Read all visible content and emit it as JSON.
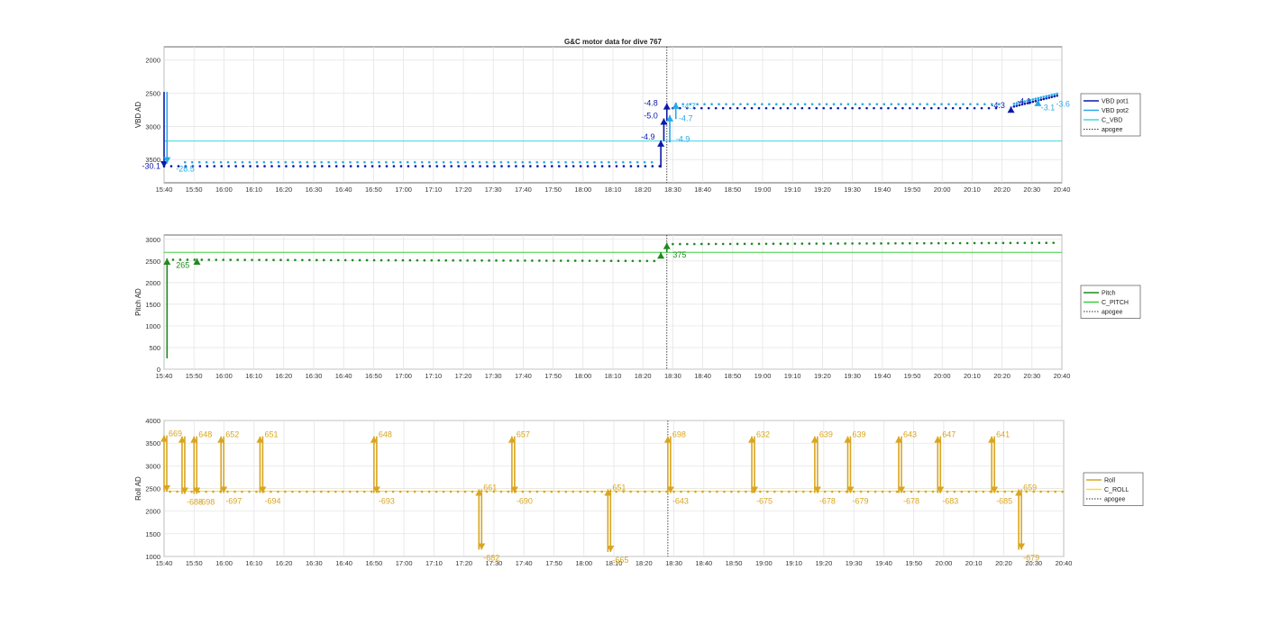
{
  "figure": {
    "title": "G&C motor data for dive 767"
  },
  "chart_data": [
    {
      "type": "scatter",
      "id": "vbd",
      "ylabel": "VBD AD",
      "ylim": [
        3850,
        1800
      ],
      "yticks": [
        2000,
        2500,
        3000,
        3500
      ],
      "xlim": [
        "15:40",
        "20:40"
      ],
      "xticks": [
        "15:40",
        "15:50",
        "16:00",
        "16:10",
        "16:20",
        "16:30",
        "16:40",
        "16:50",
        "17:00",
        "17:10",
        "17:20",
        "17:30",
        "17:40",
        "17:50",
        "18:00",
        "18:10",
        "18:20",
        "18:30",
        "18:40",
        "18:50",
        "19:00",
        "19:10",
        "19:20",
        "19:30",
        "19:40",
        "19:50",
        "20:00",
        "20:10",
        "20:20",
        "20:30",
        "20:40"
      ],
      "grid": true,
      "legend": {
        "placement": "right",
        "entries": [
          {
            "label": "VBD pot1",
            "color": "#0a1aa8",
            "style": "solid"
          },
          {
            "label": "VBD pot2",
            "color": "#2aa8e8",
            "style": "solid"
          },
          {
            "label": "C_VBD",
            "color": "#3fd6e6",
            "style": "solid"
          },
          {
            "label": "apogee",
            "color": "#333333",
            "style": "dotted"
          }
        ]
      },
      "reference_lines": [
        {
          "name": "C_VBD",
          "y": 3220,
          "color": "#3fd6e6"
        }
      ],
      "apogee_x": "18:28",
      "series": [
        {
          "name": "VBD pot1",
          "color": "#0a1aa8",
          "segments": [
            {
              "x": [
                "15:40",
                "18:26"
              ],
              "y": 3600
            },
            {
              "x": [
                "18:30",
                "20:20"
              ],
              "y": 2725
            },
            {
              "x": [
                "20:24",
                "20:39"
              ],
              "y": [
                2700,
                2530
              ]
            }
          ]
        },
        {
          "name": "VBD pot2",
          "color": "#2aa8e8",
          "segments": [
            {
              "x": [
                "15:47",
                "18:25"
              ],
              "y": 3540
            },
            {
              "x": [
                "18:31",
                "20:20"
              ],
              "y": 2665
            },
            {
              "x": [
                "20:24",
                "20:39"
              ],
              "y": [
                2660,
                2500
              ]
            }
          ]
        }
      ],
      "arrows": [
        {
          "x": "15:40",
          "from": 2480,
          "to": 3620,
          "color": "#0a1aa8"
        },
        {
          "x": "15:41",
          "from": 2480,
          "to": 3560,
          "color": "#2aa8e8"
        },
        {
          "x": "18:26",
          "from": 3620,
          "to": 3210,
          "color": "#0a1aa8"
        },
        {
          "x": "18:27",
          "from": 3220,
          "to": 2880,
          "color": "#0a1aa8"
        },
        {
          "x": "18:28",
          "from": 2920,
          "to": 2650,
          "color": "#0a1aa8"
        },
        {
          "x": "18:29",
          "from": 3240,
          "to": 2830,
          "color": "#2aa8e8"
        },
        {
          "x": "18:31",
          "from": 2890,
          "to": 2640,
          "color": "#2aa8e8"
        },
        {
          "x": "20:23",
          "from": 2735,
          "to": 2700,
          "color": "#0a1aa8"
        },
        {
          "x": "20:32",
          "from": 2680,
          "to": 2600,
          "color": "#2aa8e8"
        }
      ],
      "annotations": [
        {
          "text": "-30.1",
          "x": "15:40",
          "y": 3640,
          "color": "#0a1aa8",
          "anchor": "end",
          "dx": -4
        },
        {
          "text": "-28.5",
          "x": "15:44",
          "y": 3680,
          "color": "#2aa8e8",
          "anchor": "start"
        },
        {
          "text": "-4.8",
          "x": "18:25",
          "y": 2690,
          "color": "#0a1aa8",
          "anchor": "end"
        },
        {
          "text": "-5.0",
          "x": "18:25",
          "y": 2880,
          "color": "#0a1aa8",
          "anchor": "end"
        },
        {
          "text": "-4.9",
          "x": "18:24",
          "y": 3200,
          "color": "#0a1aa8",
          "anchor": "end"
        },
        {
          "text": "-4.7",
          "x": "18:33",
          "y": 2740,
          "color": "#2aa8e8",
          "anchor": "start"
        },
        {
          "text": "-4.7",
          "x": "18:32",
          "y": 2920,
          "color": "#2aa8e8",
          "anchor": "start"
        },
        {
          "text": "-4.9",
          "x": "18:31",
          "y": 3230,
          "color": "#2aa8e8",
          "anchor": "start"
        },
        {
          "text": "-4.3",
          "x": "20:21",
          "y": 2720,
          "color": "#0a1aa8",
          "anchor": "end"
        },
        {
          "text": "-4.1",
          "x": "20:25",
          "y": 2660,
          "color": "#0a1aa8",
          "anchor": "start"
        },
        {
          "text": "-3.1",
          "x": "20:33",
          "y": 2760,
          "color": "#2aa8e8",
          "anchor": "start"
        },
        {
          "text": "-3.6",
          "x": "20:38",
          "y": 2700,
          "color": "#2aa8e8",
          "anchor": "start"
        }
      ]
    },
    {
      "type": "scatter",
      "id": "pitch",
      "ylabel": "Pitch AD",
      "ylim": [
        0,
        3100
      ],
      "yticks": [
        0,
        500,
        1000,
        1500,
        2000,
        2500,
        3000
      ],
      "xlim": [
        "15:40",
        "20:40"
      ],
      "xticks": [
        "15:40",
        "15:50",
        "16:00",
        "16:10",
        "16:20",
        "16:30",
        "16:40",
        "16:50",
        "17:00",
        "17:10",
        "17:20",
        "17:30",
        "17:40",
        "17:50",
        "18:00",
        "18:10",
        "18:20",
        "18:30",
        "18:40",
        "18:50",
        "19:00",
        "19:10",
        "19:20",
        "19:30",
        "19:40",
        "19:50",
        "20:00",
        "20:10",
        "20:20",
        "20:30",
        "20:40"
      ],
      "grid": true,
      "legend": {
        "placement": "right",
        "entries": [
          {
            "label": "Pitch",
            "color": "#1e8a1e",
            "style": "solid"
          },
          {
            "label": "C_PITCH",
            "color": "#3ccf3c",
            "style": "solid"
          },
          {
            "label": "apogee",
            "color": "#333333",
            "style": "dotted"
          }
        ]
      },
      "reference_lines": [
        {
          "name": "C_PITCH",
          "y": 2700,
          "color": "#3ccf3c"
        }
      ],
      "apogee_x": "18:28",
      "series": [
        {
          "name": "Pitch",
          "color": "#1e8a1e",
          "segments": [
            {
              "x": [
                "15:43",
                "18:26"
              ],
              "y": [
                2530,
                2500
              ]
            },
            {
              "x": [
                "18:30",
                "20:39"
              ],
              "y": [
                2890,
                2920
              ]
            }
          ]
        }
      ],
      "arrows": [
        {
          "x": "15:41",
          "from": 250,
          "to": 2560,
          "color": "#1e8a1e"
        },
        {
          "x": "15:51",
          "from": 2490,
          "to": 2560,
          "color": "#1e8a1e"
        },
        {
          "x": "18:26",
          "from": 2560,
          "to": 2700,
          "color": "#1e8a1e"
        },
        {
          "x": "18:28",
          "from": 2700,
          "to": 2920,
          "color": "#1e8a1e"
        }
      ],
      "annotations": [
        {
          "text": "265",
          "x": "15:44",
          "y": 2340,
          "color": "#1e8a1e",
          "anchor": "start"
        },
        {
          "text": "375",
          "x": "18:30",
          "y": 2580,
          "color": "#1e8a1e",
          "anchor": "start"
        }
      ]
    },
    {
      "type": "scatter",
      "id": "roll",
      "ylabel": "Roll AD",
      "ylim": [
        1000,
        4000
      ],
      "yticks": [
        1000,
        1500,
        2000,
        2500,
        3000,
        3500,
        4000
      ],
      "xlim": [
        "15:40",
        "20:40"
      ],
      "xticks": [
        "15:40",
        "15:50",
        "16:00",
        "16:10",
        "16:20",
        "16:30",
        "16:40",
        "16:50",
        "17:00",
        "17:10",
        "17:20",
        "17:30",
        "17:40",
        "17:50",
        "18:00",
        "18:10",
        "18:20",
        "18:30",
        "18:40",
        "18:50",
        "19:00",
        "19:10",
        "19:20",
        "19:30",
        "19:40",
        "19:50",
        "20:00",
        "20:10",
        "20:20",
        "20:30",
        "20:40"
      ],
      "grid": true,
      "legend": {
        "placement": "right",
        "entries": [
          {
            "label": "Roll",
            "color": "#d9a520",
            "style": "solid"
          },
          {
            "label": "C_ROLL",
            "color": "#f0e040",
            "style": "solid"
          },
          {
            "label": "apogee",
            "color": "#333333",
            "style": "dotted"
          }
        ]
      },
      "reference_lines": [
        {
          "name": "C_ROLL",
          "y": 2440,
          "color": "#f0e040"
        }
      ],
      "apogee_x": "18:28",
      "series": [
        {
          "name": "Roll",
          "color": "#d9a520",
          "segments": [
            {
              "x": [
                "15:42",
                "20:40"
              ],
              "y": 2430
            }
          ]
        }
      ],
      "roll_events": [
        {
          "x": "15:40",
          "y": 3670,
          "to": 2430,
          "up": "669",
          "down": ""
        },
        {
          "x": "15:46",
          "y": 3650,
          "to": 2380,
          "up": "",
          "down": "-688"
        },
        {
          "x": "15:50",
          "y": 3650,
          "to": 2380,
          "up": "648",
          "down": "-698"
        },
        {
          "x": "15:59",
          "y": 3650,
          "to": 2400,
          "up": "652",
          "down": "-697"
        },
        {
          "x": "16:12",
          "y": 3650,
          "to": 2400,
          "up": "651",
          "down": "-694"
        },
        {
          "x": "16:50",
          "y": 3650,
          "to": 2400,
          "up": "648",
          "down": "-693"
        },
        {
          "x": "17:25",
          "y": 2480,
          "to": 1150,
          "up": "661",
          "down": "-682"
        },
        {
          "x": "17:36",
          "y": 3650,
          "to": 2400,
          "up": "657",
          "down": "-690"
        },
        {
          "x": "18:08",
          "y": 2480,
          "to": 1100,
          "up": "651",
          "down": "-665"
        },
        {
          "x": "18:28",
          "y": 3650,
          "to": 2400,
          "up": "698",
          "down": "-643"
        },
        {
          "x": "18:56",
          "y": 3650,
          "to": 2400,
          "up": "632",
          "down": "-675"
        },
        {
          "x": "19:17",
          "y": 3650,
          "to": 2400,
          "up": "639",
          "down": "-678"
        },
        {
          "x": "19:28",
          "y": 3650,
          "to": 2400,
          "up": "639",
          "down": "-679"
        },
        {
          "x": "19:45",
          "y": 3650,
          "to": 2400,
          "up": "643",
          "down": "-678"
        },
        {
          "x": "19:58",
          "y": 3650,
          "to": 2400,
          "up": "647",
          "down": "-683"
        },
        {
          "x": "20:16",
          "y": 3650,
          "to": 2400,
          "up": "641",
          "down": "-685"
        },
        {
          "x": "20:25",
          "y": 2480,
          "to": 1150,
          "up": "659",
          "down": "-679"
        }
      ]
    }
  ]
}
